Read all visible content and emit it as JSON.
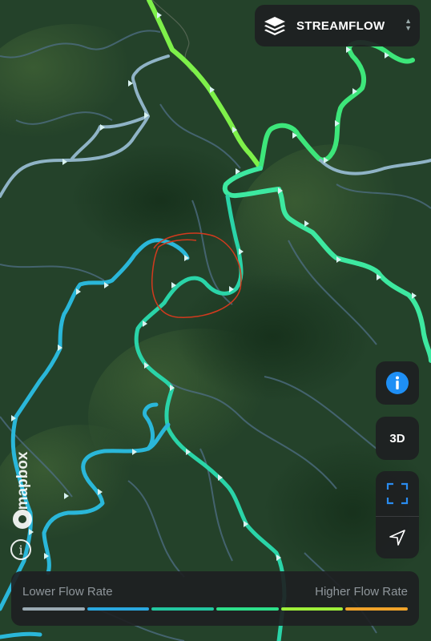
{
  "layer_selector": {
    "label": "STREAMFLOW",
    "icon": "layers-icon"
  },
  "controls": {
    "info": {
      "icon": "info-icon"
    },
    "three_d": {
      "label": "3D"
    },
    "fullscreen": {
      "icon": "fullscreen-icon"
    },
    "locate": {
      "icon": "location-arrow-icon"
    }
  },
  "legend": {
    "low_label": "Lower Flow Rate",
    "high_label": "Higher Flow Rate",
    "colors": [
      "#9aaab3",
      "#2aa8e0",
      "#23c7a0",
      "#2de08a",
      "#9ef03a",
      "#f0a32a"
    ]
  },
  "attribution": {
    "logo_text": "mapbox",
    "info_icon": "attribution-info-icon"
  },
  "annotation": {
    "color": "#d23a1e",
    "description": "hand-drawn circle"
  }
}
